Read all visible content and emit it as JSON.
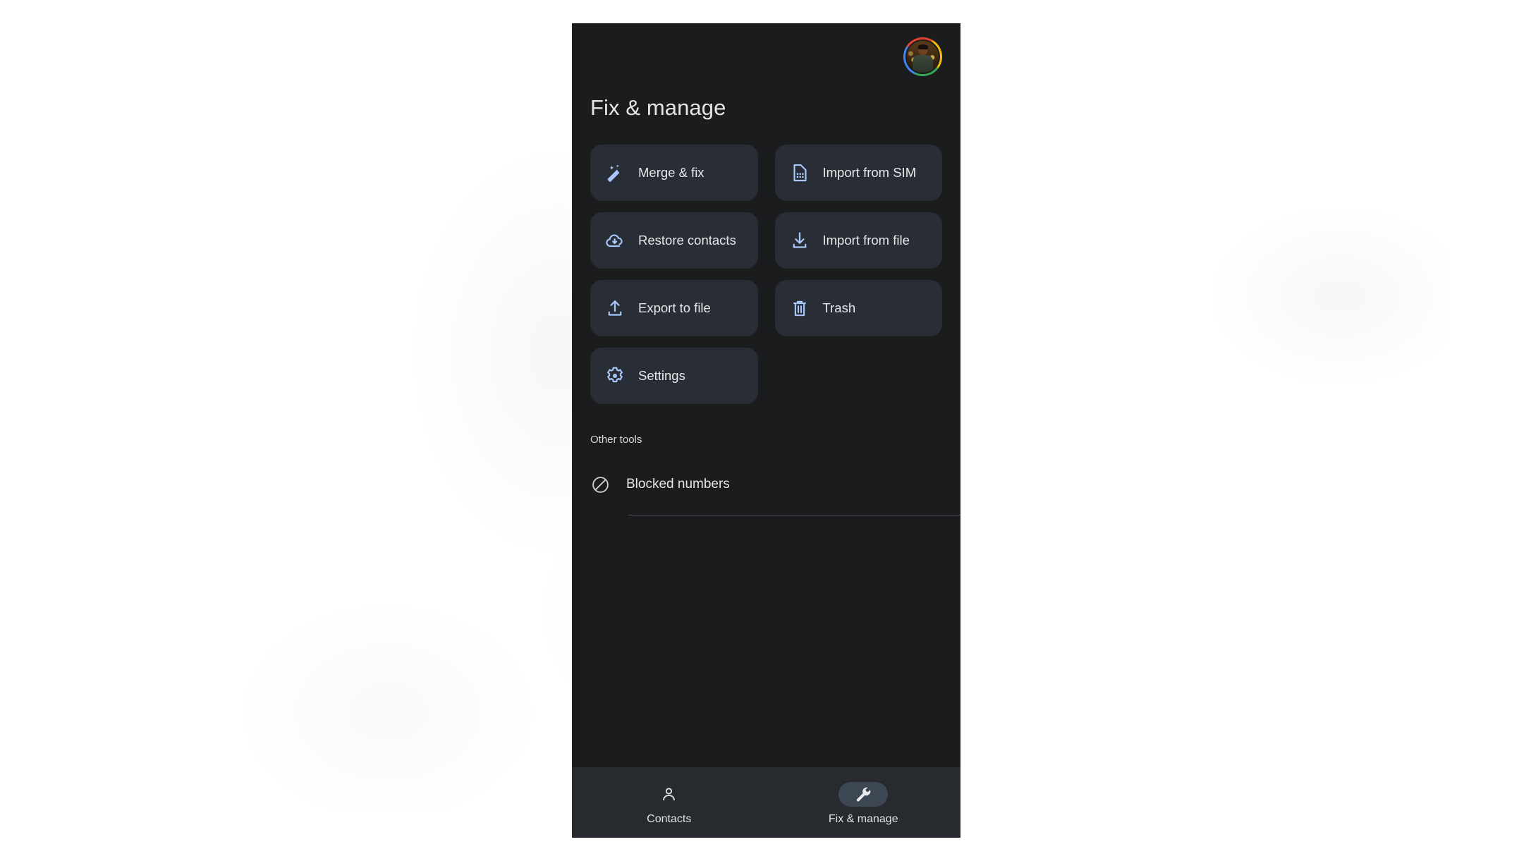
{
  "app": {
    "window_background": "#1b1c1e",
    "accent_icon_color": "#a8c7fa",
    "tile_background": "#292d35",
    "nav_background": "#272a2e",
    "active_pill_color": "#3d4653"
  },
  "header": {
    "title": "Fix & manage",
    "avatar_name": "account-avatar"
  },
  "tools": [
    {
      "label": "Merge & fix",
      "icon": "magic-wand-icon"
    },
    {
      "label": "Import from SIM",
      "icon": "sim-card-icon"
    },
    {
      "label": "Restore contacts",
      "icon": "cloud-download-icon"
    },
    {
      "label": "Import from file",
      "icon": "download-icon"
    },
    {
      "label": "Export to file",
      "icon": "upload-icon"
    },
    {
      "label": "Trash",
      "icon": "trash-icon"
    },
    {
      "label": "Settings",
      "icon": "gear-icon"
    }
  ],
  "other_tools": {
    "section_label": "Other tools",
    "items": [
      {
        "label": "Blocked numbers",
        "icon": "block-icon"
      }
    ]
  },
  "bottom_nav": {
    "items": [
      {
        "label": "Contacts",
        "icon": "person-icon",
        "active": false
      },
      {
        "label": "Fix & manage",
        "icon": "wrench-icon",
        "active": true
      }
    ]
  }
}
